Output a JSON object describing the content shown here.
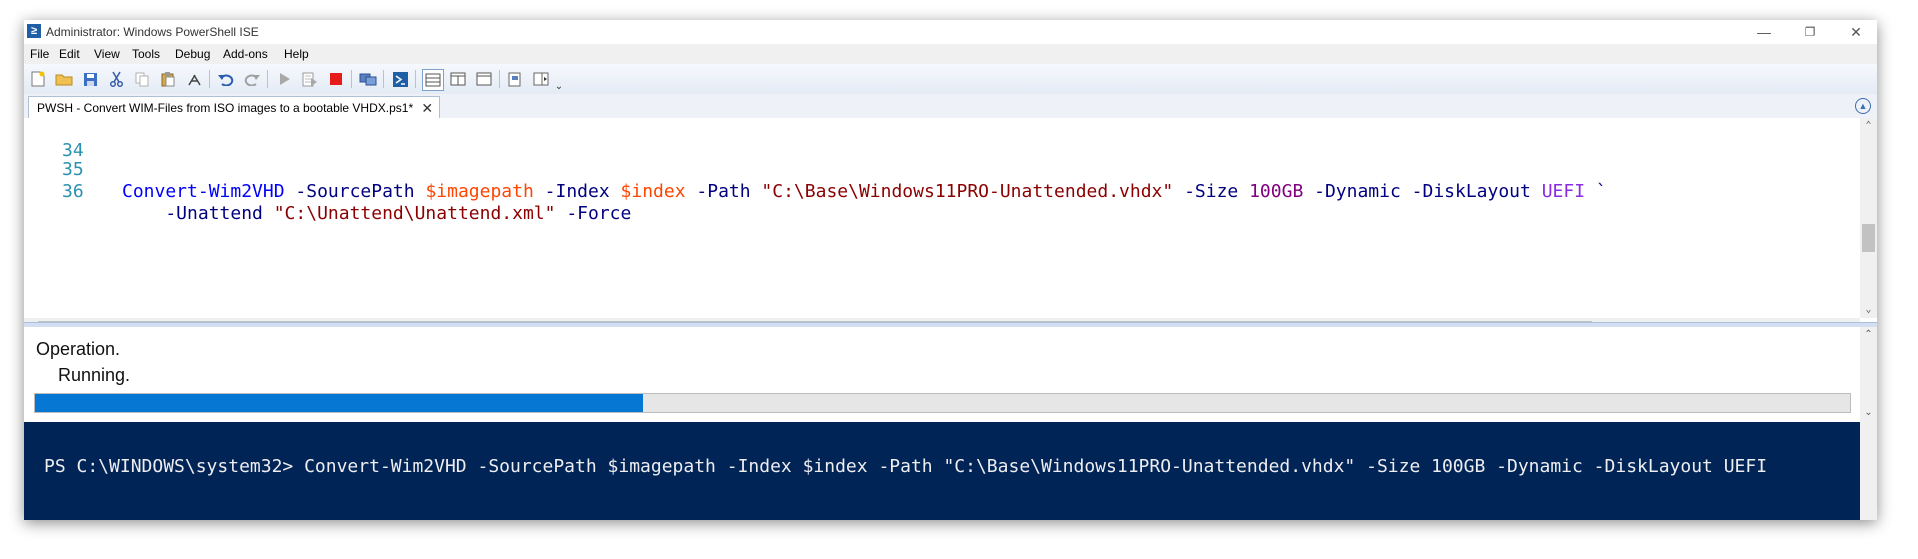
{
  "window": {
    "title": "Administrator: Windows PowerShell ISE",
    "controls": {
      "minimize": "—",
      "restore": "❐",
      "close": "✕"
    }
  },
  "menu": [
    "File",
    "Edit",
    "View",
    "Tools",
    "Debug",
    "Add-ons",
    "Help"
  ],
  "toolbar": {
    "icons": [
      "new-file-icon",
      "open-folder-icon",
      "save-icon",
      "cut-icon",
      "copy-icon",
      "paste-icon",
      "clear-icon",
      "undo-icon",
      "redo-icon",
      "run-script-icon",
      "run-selection-icon",
      "stop-icon",
      "new-remote-tab-icon",
      "start-powershell-icon",
      "show-script-pane-top-icon",
      "show-script-pane-right-icon",
      "show-script-pane-maximized-icon",
      "show-command-window-icon",
      "show-command-addon-icon"
    ],
    "more": "⌄"
  },
  "tab": {
    "label": "PWSH - Convert WIM-Files from ISO images to a bootable VHDX.ps1*",
    "close": "✕"
  },
  "editor": {
    "lines": [
      {
        "num": "34",
        "tokens": []
      },
      {
        "num": "35",
        "tokens": [
          {
            "t": "Convert-Wim2VHD",
            "c": "cmd"
          },
          {
            "t": " -SourcePath ",
            "c": "par"
          },
          {
            "t": "$imagepath",
            "c": "var"
          },
          {
            "t": " -Index ",
            "c": "par"
          },
          {
            "t": "$index",
            "c": "var"
          },
          {
            "t": " -Path ",
            "c": "par"
          },
          {
            "t": "\"C:\\Base\\Windows11PRO-Unattended.vhdx\"",
            "c": "str"
          },
          {
            "t": " -Size ",
            "c": "par"
          },
          {
            "t": "100GB",
            "c": "num"
          },
          {
            "t": " -Dynamic -DiskLayout ",
            "c": "par"
          },
          {
            "t": "UEFI",
            "c": "kw"
          },
          {
            "t": " `",
            "c": "par"
          }
        ]
      },
      {
        "num": "36",
        "tokens": [
          {
            "t": "    -Unattend ",
            "c": "par"
          },
          {
            "t": "\"C:\\Unattend\\Unattend.xml\"",
            "c": "str"
          },
          {
            "t": " -Force",
            "c": "par"
          }
        ]
      }
    ]
  },
  "output": {
    "line1": "Operation.",
    "line2": "Running.",
    "progress": 0.335
  },
  "console": {
    "prompt": "PS C:\\WINDOWS\\system32> Convert-Wim2VHD -SourcePath $imagepath -Index $index -Path \"C:\\Base\\Windows11PRO-Unattended.vhdx\" -Size 100GB -Dynamic -DiskLayout UEFI"
  },
  "colors": {
    "console_bg": "#012456",
    "progress_fill": "#0678d4",
    "cmdlet": "#0000ff",
    "parameter": "#000080",
    "variable": "#ff4500",
    "string": "#8b0000",
    "number": "#800080",
    "keyword": "#8a2be2",
    "line_number": "#2b91af"
  }
}
